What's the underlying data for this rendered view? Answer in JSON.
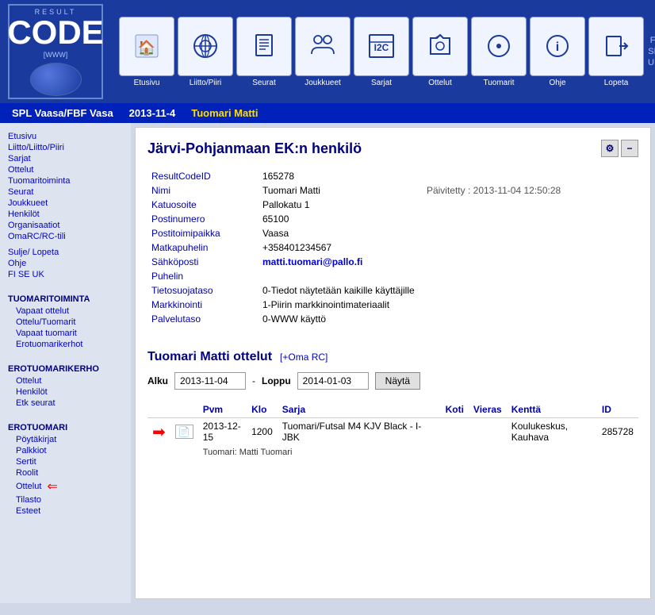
{
  "logo": {
    "result": "RESULT",
    "code": "CODE",
    "www": "[WWW]"
  },
  "nav": {
    "items": [
      {
        "label": "Etusivu",
        "icon": "🏠"
      },
      {
        "label": "Liitto/Piiri",
        "icon": "⚽"
      },
      {
        "label": "Seurat",
        "icon": "🏆"
      },
      {
        "label": "Joukkueet",
        "icon": "👥"
      },
      {
        "label": "Sarjat",
        "icon": "📋"
      },
      {
        "label": "Ottelut",
        "icon": "🛡"
      },
      {
        "label": "Tuomarit",
        "icon": "⭕"
      },
      {
        "label": "Ohje",
        "icon": "ℹ"
      },
      {
        "label": "Lopeta",
        "icon": "🚪"
      }
    ],
    "languages": [
      "FI",
      "SE",
      "UK"
    ]
  },
  "breadcrumb": {
    "org": "SPL Vaasa/FBF Vasa",
    "date": "2013-11-4",
    "name": "Tuomari Matti"
  },
  "sidebar": {
    "links": [
      {
        "label": "Etusivu",
        "indent": false
      },
      {
        "label": "Liitto/Liitto/Piiri",
        "indent": false
      },
      {
        "label": "Sarjat",
        "indent": false
      },
      {
        "label": "Ottelut",
        "indent": false
      },
      {
        "label": "Tuomaritoiminta",
        "indent": false
      },
      {
        "label": "Seurat",
        "indent": false
      },
      {
        "label": "Joukkueet",
        "indent": false
      },
      {
        "label": "Henkilöt",
        "indent": false
      },
      {
        "label": "Organisaatiot",
        "indent": false
      },
      {
        "label": "OmaRC/RC-tili",
        "indent": false
      }
    ],
    "links2": [
      {
        "label": "Sulje/ Lopeta"
      },
      {
        "label": "Ohje"
      },
      {
        "label": "FI  SE  UK"
      }
    ],
    "tuomaritoiminta": {
      "title": "TUOMARITOIMINTA",
      "items": [
        "Vapaat ottelut",
        "Ottelu/Tuomarit",
        "Vapaat tuomarit",
        "Erotuomarikerhot"
      ]
    },
    "erotuomarikerho": {
      "title": "EROTUOMARIKERHO",
      "items": [
        "Ottelut",
        "Henkilöt",
        "Etk seurat"
      ]
    },
    "erotuomari": {
      "title": "EROTUOMARI",
      "items": [
        "Pöytäkirjat",
        "Palkkiot",
        "Sertit",
        "Roolit",
        "Ottelut",
        "Tilasto",
        "Esteet"
      ]
    }
  },
  "person": {
    "page_title": "Järvi-Pohjanmaan EK:n henkilö",
    "fields": {
      "result_code_id_label": "ResultCodeID",
      "result_code_id_value": "165278",
      "nimi_label": "Nimi",
      "nimi_value": "Tuomari Matti",
      "updated_label": "Päivitetty :",
      "updated_value": "2013-11-04 12:50:28",
      "katuosoite_label": "Katuosoite",
      "katuosoite_value": "Pallokatu 1",
      "postinumero_label": "Postinumero",
      "postinumero_value": "65100",
      "postitoimipaikka_label": "Postitoimipaikka",
      "postitoimipaikka_value": "Vaasa",
      "matkapuhelin_label": "Matkapuhelin",
      "matkapuhelin_value": "+358401234567",
      "sahkoposti_label": "Sähköposti",
      "sahkoposti_value": "matti.tuomari@pallo.fi",
      "puhelin_label": "Puhelin",
      "puhelin_value": "",
      "tietosuojataso_label": "Tietosuojataso",
      "tietosuojataso_value": "0-Tiedot näytetään kaikille käyttäjille",
      "markkinointi_label": "Markkinointi",
      "markkinointi_value": "1-Piirin markkinointimateriaalit",
      "palvelutaso_label": "Palvelutaso",
      "palvelutaso_value": "0-WWW käyttö"
    },
    "matches_section": {
      "title": "Tuomari Matti ottelut",
      "oma_rc_link": "[+Oma RC]",
      "alku_label": "Alku",
      "loppu_label": "Loppu",
      "alku_value": "2013-11-04",
      "loppu_value": "2014-01-03",
      "nayta_label": "Näytä"
    },
    "table": {
      "headers": [
        "Pvm",
        "Klo",
        "Sarja",
        "Koti",
        "Vieras",
        "Kenttä",
        "ID"
      ],
      "rows": [
        {
          "pvm": "2013-12-15",
          "klo": "1200",
          "sarja": "Tuomari/Futsal M4 KJV Black - I-JBK",
          "koti": "",
          "vieras": "",
          "kentta": "Koulukeskus, Kauhava",
          "id": "285728"
        }
      ],
      "sub_info": "Tuomari: Matti Tuomari"
    }
  }
}
